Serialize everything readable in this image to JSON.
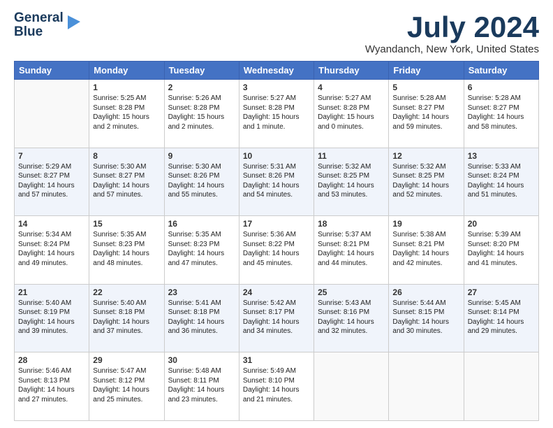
{
  "logo": {
    "line1": "General",
    "line2": "Blue",
    "icon": "▶"
  },
  "title": "July 2024",
  "location": "Wyandanch, New York, United States",
  "days_header": [
    "Sunday",
    "Monday",
    "Tuesday",
    "Wednesday",
    "Thursday",
    "Friday",
    "Saturday"
  ],
  "weeks": [
    [
      {
        "day": "",
        "sunrise": "",
        "sunset": "",
        "daylight": ""
      },
      {
        "day": "1",
        "sunrise": "5:25 AM",
        "sunset": "8:28 PM",
        "daylight": "15 hours and 2 minutes."
      },
      {
        "day": "2",
        "sunrise": "5:26 AM",
        "sunset": "8:28 PM",
        "daylight": "15 hours and 2 minutes."
      },
      {
        "day": "3",
        "sunrise": "5:27 AM",
        "sunset": "8:28 PM",
        "daylight": "15 hours and 1 minute."
      },
      {
        "day": "4",
        "sunrise": "5:27 AM",
        "sunset": "8:28 PM",
        "daylight": "15 hours and 0 minutes."
      },
      {
        "day": "5",
        "sunrise": "5:28 AM",
        "sunset": "8:27 PM",
        "daylight": "14 hours and 59 minutes."
      },
      {
        "day": "6",
        "sunrise": "5:28 AM",
        "sunset": "8:27 PM",
        "daylight": "14 hours and 58 minutes."
      }
    ],
    [
      {
        "day": "7",
        "sunrise": "5:29 AM",
        "sunset": "8:27 PM",
        "daylight": "14 hours and 57 minutes."
      },
      {
        "day": "8",
        "sunrise": "5:30 AM",
        "sunset": "8:27 PM",
        "daylight": "14 hours and 57 minutes."
      },
      {
        "day": "9",
        "sunrise": "5:30 AM",
        "sunset": "8:26 PM",
        "daylight": "14 hours and 55 minutes."
      },
      {
        "day": "10",
        "sunrise": "5:31 AM",
        "sunset": "8:26 PM",
        "daylight": "14 hours and 54 minutes."
      },
      {
        "day": "11",
        "sunrise": "5:32 AM",
        "sunset": "8:25 PM",
        "daylight": "14 hours and 53 minutes."
      },
      {
        "day": "12",
        "sunrise": "5:32 AM",
        "sunset": "8:25 PM",
        "daylight": "14 hours and 52 minutes."
      },
      {
        "day": "13",
        "sunrise": "5:33 AM",
        "sunset": "8:24 PM",
        "daylight": "14 hours and 51 minutes."
      }
    ],
    [
      {
        "day": "14",
        "sunrise": "5:34 AM",
        "sunset": "8:24 PM",
        "daylight": "14 hours and 49 minutes."
      },
      {
        "day": "15",
        "sunrise": "5:35 AM",
        "sunset": "8:23 PM",
        "daylight": "14 hours and 48 minutes."
      },
      {
        "day": "16",
        "sunrise": "5:35 AM",
        "sunset": "8:23 PM",
        "daylight": "14 hours and 47 minutes."
      },
      {
        "day": "17",
        "sunrise": "5:36 AM",
        "sunset": "8:22 PM",
        "daylight": "14 hours and 45 minutes."
      },
      {
        "day": "18",
        "sunrise": "5:37 AM",
        "sunset": "8:21 PM",
        "daylight": "14 hours and 44 minutes."
      },
      {
        "day": "19",
        "sunrise": "5:38 AM",
        "sunset": "8:21 PM",
        "daylight": "14 hours and 42 minutes."
      },
      {
        "day": "20",
        "sunrise": "5:39 AM",
        "sunset": "8:20 PM",
        "daylight": "14 hours and 41 minutes."
      }
    ],
    [
      {
        "day": "21",
        "sunrise": "5:40 AM",
        "sunset": "8:19 PM",
        "daylight": "14 hours and 39 minutes."
      },
      {
        "day": "22",
        "sunrise": "5:40 AM",
        "sunset": "8:18 PM",
        "daylight": "14 hours and 37 minutes."
      },
      {
        "day": "23",
        "sunrise": "5:41 AM",
        "sunset": "8:18 PM",
        "daylight": "14 hours and 36 minutes."
      },
      {
        "day": "24",
        "sunrise": "5:42 AM",
        "sunset": "8:17 PM",
        "daylight": "14 hours and 34 minutes."
      },
      {
        "day": "25",
        "sunrise": "5:43 AM",
        "sunset": "8:16 PM",
        "daylight": "14 hours and 32 minutes."
      },
      {
        "day": "26",
        "sunrise": "5:44 AM",
        "sunset": "8:15 PM",
        "daylight": "14 hours and 30 minutes."
      },
      {
        "day": "27",
        "sunrise": "5:45 AM",
        "sunset": "8:14 PM",
        "daylight": "14 hours and 29 minutes."
      }
    ],
    [
      {
        "day": "28",
        "sunrise": "5:46 AM",
        "sunset": "8:13 PM",
        "daylight": "14 hours and 27 minutes."
      },
      {
        "day": "29",
        "sunrise": "5:47 AM",
        "sunset": "8:12 PM",
        "daylight": "14 hours and 25 minutes."
      },
      {
        "day": "30",
        "sunrise": "5:48 AM",
        "sunset": "8:11 PM",
        "daylight": "14 hours and 23 minutes."
      },
      {
        "day": "31",
        "sunrise": "5:49 AM",
        "sunset": "8:10 PM",
        "daylight": "14 hours and 21 minutes."
      },
      {
        "day": "",
        "sunrise": "",
        "sunset": "",
        "daylight": ""
      },
      {
        "day": "",
        "sunrise": "",
        "sunset": "",
        "daylight": ""
      },
      {
        "day": "",
        "sunrise": "",
        "sunset": "",
        "daylight": ""
      }
    ]
  ],
  "labels": {
    "sunrise_prefix": "Sunrise: ",
    "sunset_prefix": "Sunset: ",
    "daylight_prefix": "Daylight: "
  }
}
